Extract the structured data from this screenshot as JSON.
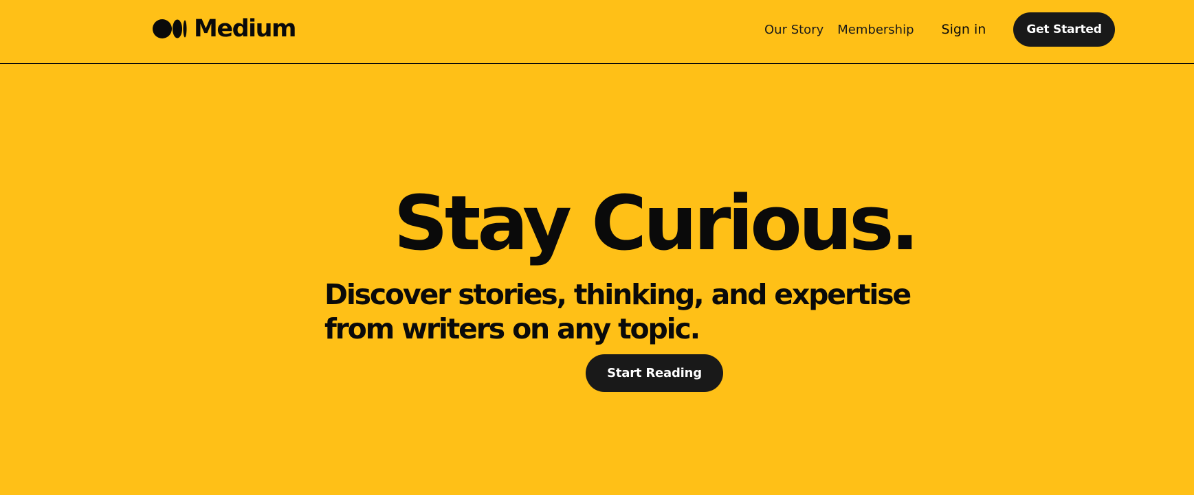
{
  "brand": {
    "name": "Medium",
    "logo_icon": "medium-logo-icon"
  },
  "nav": {
    "our_story": "Our Story",
    "membership": "Membership",
    "sign_in": "Sign in",
    "get_started": "Get Started"
  },
  "hero": {
    "title": "Stay Curious.",
    "subtitle": "Discover stories, thinking, and expertise from writers on any topic.",
    "cta": "Start Reading"
  },
  "colors": {
    "background": "#FFC017",
    "text": "#0a0a0a",
    "button_bg": "#191919",
    "button_text": "#ffffff"
  }
}
